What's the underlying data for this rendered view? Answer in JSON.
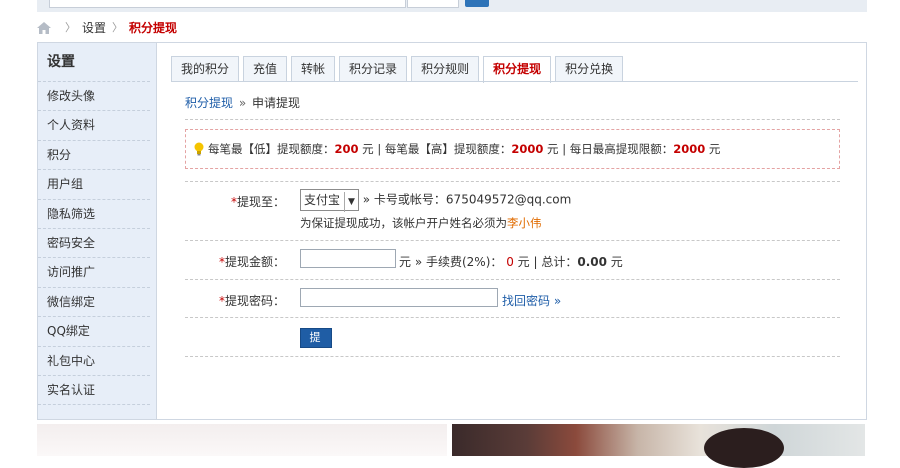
{
  "breadcrumb": {
    "items": [
      "设置",
      "积分提现"
    ]
  },
  "sidebar": {
    "title": "设置",
    "items": [
      "修改头像",
      "个人资料",
      "积分",
      "用户组",
      "隐私筛选",
      "密码安全",
      "访问推广",
      "微信绑定",
      "QQ绑定",
      "礼包中心",
      "实名认证"
    ]
  },
  "tabs": [
    "我的积分",
    "充值",
    "转帐",
    "积分记录",
    "积分规则",
    "积分提现",
    "积分兑换"
  ],
  "active_tab": "积分提现",
  "subnav": {
    "link": "积分提现",
    "separator": "»",
    "current": "申请提现"
  },
  "notice": {
    "min_label": "每笔最【低】提现额度：",
    "min_value": "200",
    "unit1": "元",
    "max_label": "| 每笔最【高】提现额度：",
    "max_value": "2000",
    "unit2": "元",
    "daily_label": "| 每日最高提现限额：",
    "daily_value": "2000",
    "unit3": "元"
  },
  "form": {
    "to_label": "提现至：",
    "method": "支付宝",
    "account_text": "» 卡号或帐号：675049572@qq.com",
    "name_hint_prefix": "为保证提现成功，该帐户开户姓名必须为",
    "name_value": "李小伟",
    "amount_label": "提现金额：",
    "amount_suffix": "元 » 手续费(2%)：",
    "fee_value": "0",
    "fee_unit": "元 | 总计：",
    "total_value": "0.00",
    "total_unit": "元",
    "password_label": "提现密码：",
    "forgot_link": "找回密码 »",
    "submit_label": "提 交",
    "required_mark": "*"
  },
  "colors": {
    "accent": "#c40000",
    "link": "#1e5da8",
    "button": "#1f5da5",
    "sidebar_bg": "#e7eef8"
  },
  "icons": {
    "home": "home-icon",
    "bulb": "lightbulb-icon"
  }
}
